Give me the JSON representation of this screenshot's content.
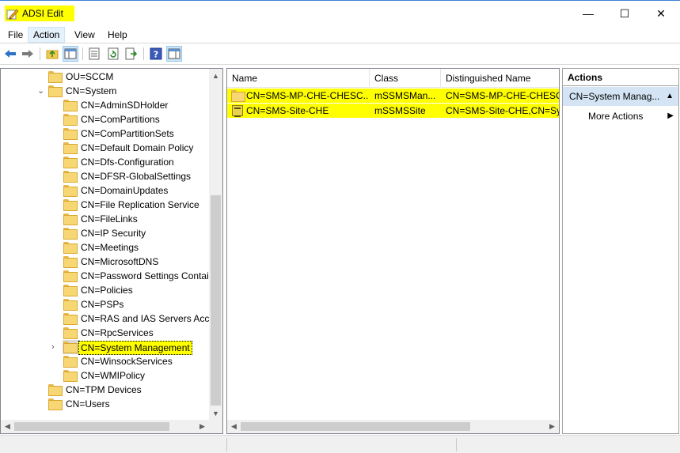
{
  "window": {
    "title": "ADSI Edit",
    "minimize_glyph": "—",
    "maximize_glyph": "☐",
    "close_glyph": "✕"
  },
  "menu": [
    {
      "label": "File",
      "active": false
    },
    {
      "label": "Action",
      "active": true
    },
    {
      "label": "View",
      "active": false
    },
    {
      "label": "Help",
      "active": false
    }
  ],
  "toolbar": {
    "icons": [
      "back-arrow-icon",
      "forward-arrow-icon",
      "up-folder-icon",
      "show-hide-console-tree-icon",
      "properties-icon",
      "refresh-icon",
      "export-list-icon",
      "help-icon",
      "show-hide-action-pane-icon"
    ]
  },
  "tree": {
    "items": [
      {
        "label": "OU=SCCM",
        "level": 1,
        "expander": ""
      },
      {
        "label": "CN=System",
        "level": 1,
        "expander": "⌄"
      },
      {
        "label": "CN=AdminSDHolder",
        "level": 2,
        "expander": ""
      },
      {
        "label": "CN=ComPartitions",
        "level": 2,
        "expander": ""
      },
      {
        "label": "CN=ComPartitionSets",
        "level": 2,
        "expander": ""
      },
      {
        "label": "CN=Default Domain Policy",
        "level": 2,
        "expander": ""
      },
      {
        "label": "CN=Dfs-Configuration",
        "level": 2,
        "expander": ""
      },
      {
        "label": "CN=DFSR-GlobalSettings",
        "level": 2,
        "expander": ""
      },
      {
        "label": "CN=DomainUpdates",
        "level": 2,
        "expander": ""
      },
      {
        "label": "CN=File Replication Service",
        "level": 2,
        "expander": ""
      },
      {
        "label": "CN=FileLinks",
        "level": 2,
        "expander": ""
      },
      {
        "label": "CN=IP Security",
        "level": 2,
        "expander": ""
      },
      {
        "label": "CN=Meetings",
        "level": 2,
        "expander": ""
      },
      {
        "label": "CN=MicrosoftDNS",
        "level": 2,
        "expander": ""
      },
      {
        "label": "CN=Password Settings Contair",
        "level": 2,
        "expander": ""
      },
      {
        "label": "CN=Policies",
        "level": 2,
        "expander": ""
      },
      {
        "label": "CN=PSPs",
        "level": 2,
        "expander": ""
      },
      {
        "label": "CN=RAS and IAS Servers Acces",
        "level": 2,
        "expander": ""
      },
      {
        "label": "CN=RpcServices",
        "level": 2,
        "expander": ""
      },
      {
        "label": "CN=System Management",
        "level": 2,
        "expander": "›",
        "selected": true
      },
      {
        "label": "CN=WinsockServices",
        "level": 2,
        "expander": ""
      },
      {
        "label": "CN=WMIPolicy",
        "level": 2,
        "expander": ""
      },
      {
        "label": "CN=TPM Devices",
        "level": 1,
        "expander": ""
      },
      {
        "label": "CN=Users",
        "level": 1,
        "expander": ""
      }
    ],
    "scroll_up_glyph": "▲",
    "scroll_down_glyph": "▼",
    "scroll_left_glyph": "◀",
    "scroll_right_glyph": "▶"
  },
  "list": {
    "columns": [
      "Name",
      "Class",
      "Distinguished Name"
    ],
    "rows": [
      {
        "name": "CN=SMS-MP-CHE-CHESC...",
        "class": "mSSMSMan...",
        "dn": "CN=SMS-MP-CHE-CHESC",
        "icon": "folder-icon"
      },
      {
        "name": "CN=SMS-Site-CHE",
        "class": "mSSMSSite",
        "dn": "CN=SMS-Site-CHE,CN=Sys",
        "icon": "sms-site-icon"
      }
    ]
  },
  "actions": {
    "title": "Actions",
    "group": "CN=System Manag...",
    "collapse_glyph": "▲",
    "items": [
      {
        "label": "More Actions",
        "arrow": "▶"
      }
    ]
  }
}
